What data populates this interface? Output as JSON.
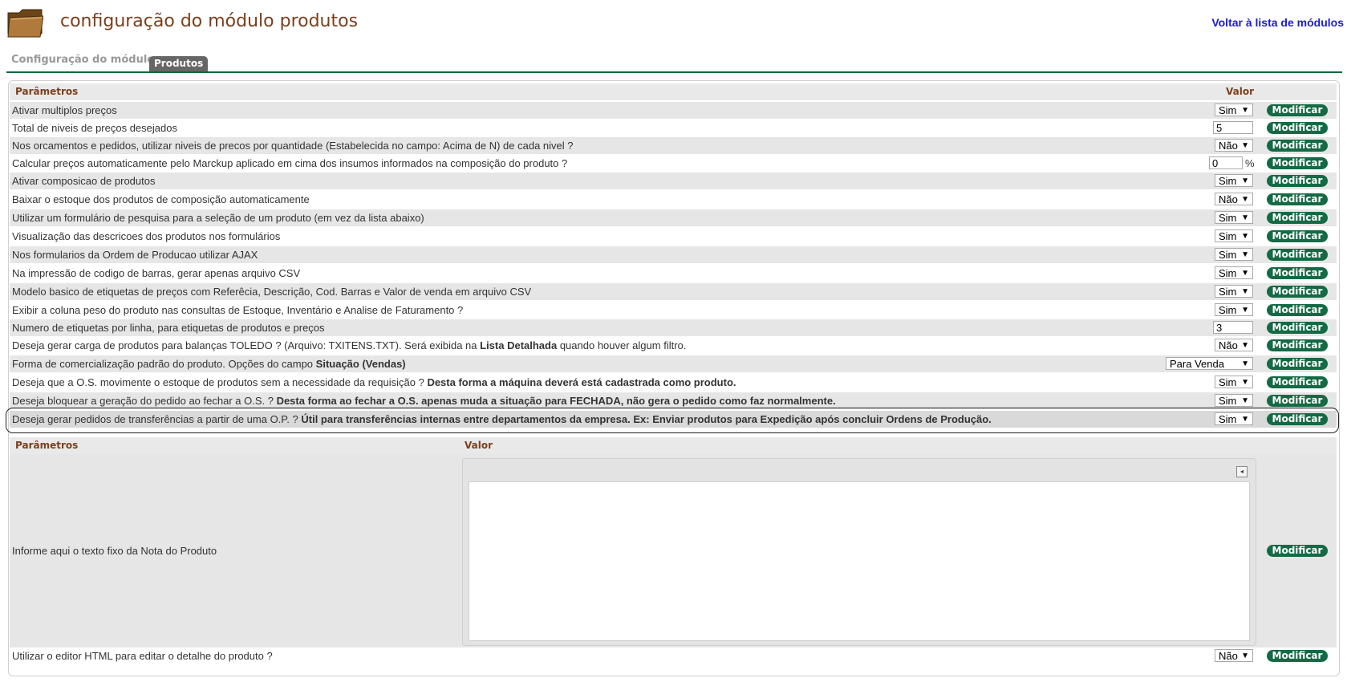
{
  "header": {
    "title": "configuração do módulo produtos",
    "back_link": "Voltar à lista de módulos"
  },
  "tabs": {
    "inactive_label": "Configuração do módulo",
    "active_label": "Produtos"
  },
  "colors": {
    "accent_green": "#146a44",
    "title_brown": "#7b3f1c",
    "link_blue": "#1a1adb"
  },
  "table1": {
    "header_param": "Parâmetros",
    "header_value": "Valor",
    "button_label": "Modificar",
    "rows": [
      {
        "label": "Ativar multiplos preços",
        "control": "select",
        "value": "Sim"
      },
      {
        "label": "Total de niveis de preços desejados",
        "control": "input",
        "value": "5"
      },
      {
        "label": "Nos orcamentos e pedidos, utilizar niveis de precos por quantidade (Estabelecida no campo: Acima de N) de cada nivel ?",
        "control": "select",
        "value": "Não"
      },
      {
        "label": "Calcular preços automaticamente pelo Marckup aplicado em cima dos insumos informados na composição do produto ?",
        "control": "input",
        "value": "0",
        "suffix": "%"
      },
      {
        "label": "Ativar composicao de produtos",
        "control": "select",
        "value": "Sim"
      },
      {
        "label": "Baixar o estoque dos produtos de composição automaticamente",
        "control": "select",
        "value": "Não"
      },
      {
        "label": "Utilizar um formulário de pesquisa para a seleção de um produto (em vez da lista abaixo)",
        "control": "select",
        "value": "Sim"
      },
      {
        "label": "Visualização das descricoes dos produtos nos formulários",
        "control": "select",
        "value": "Sim"
      },
      {
        "label": "Nos formularios da Ordem de Producao utilizar AJAX",
        "control": "select",
        "value": "Sim"
      },
      {
        "label": "Na impressão de codigo de barras, gerar apenas arquivo CSV",
        "control": "select",
        "value": "Sim"
      },
      {
        "label": "Modelo basico de etiquetas de preços com Referêcia, Descrição, Cod. Barras e Valor de venda em arquivo CSV",
        "control": "select",
        "value": "Sim"
      },
      {
        "label": "Exibir a coluna peso do produto nas consultas de Estoque, Inventário e Analise de Faturamento ?",
        "control": "select",
        "value": "Sim"
      },
      {
        "label": "Numero de etiquetas por linha, para etiquetas de produtos e preços",
        "control": "input",
        "value": "3"
      },
      {
        "label": "Deseja gerar carga de produtos para balanças TOLEDO ? (Arquivo: TXITENS.TXT). Será exibida na ",
        "bold": "Lista Detalhada",
        "after": " quando houver algum filtro.",
        "control": "select",
        "value": "Não"
      },
      {
        "label": "Forma de comercialização padrão do produto. Opções do campo ",
        "bold": "Situação (Vendas)",
        "after": "",
        "control": "select-wide",
        "value": "Para Venda"
      },
      {
        "label": "Deseja que a O.S. movimente o estoque de produtos sem a necessidade da requisição ? ",
        "bold": "Desta forma a máquina deverá está cadastrada como produto.",
        "after": "",
        "control": "select",
        "value": "Sim"
      },
      {
        "label": "Deseja bloquear a geração do pedido ao fechar a O.S. ? ",
        "bold": "Desta forma ao fechar a O.S. apenas muda a situação para FECHADA, não gera o pedido como faz normalmente.",
        "after": "",
        "control": "select",
        "value": "Sim"
      },
      {
        "label": "Deseja gerar pedidos de transferências a partir de uma O.P. ? ",
        "bold": "Útil para transferências internas entre departamentos da empresa. Ex: Enviar produtos para Expedição após concluir Ordens de Produção.",
        "after": "",
        "control": "select",
        "value": "Sim"
      }
    ]
  },
  "table2": {
    "header_param": "Parâmetros",
    "header_value": "Valor",
    "note_label": "Informe aqui o texto fixo da Nota do Produto",
    "html_editor_label": "Utilizar o editor HTML para editar o detalhe do produto ?",
    "html_editor_value": "Não",
    "button_label": "Modificar"
  }
}
